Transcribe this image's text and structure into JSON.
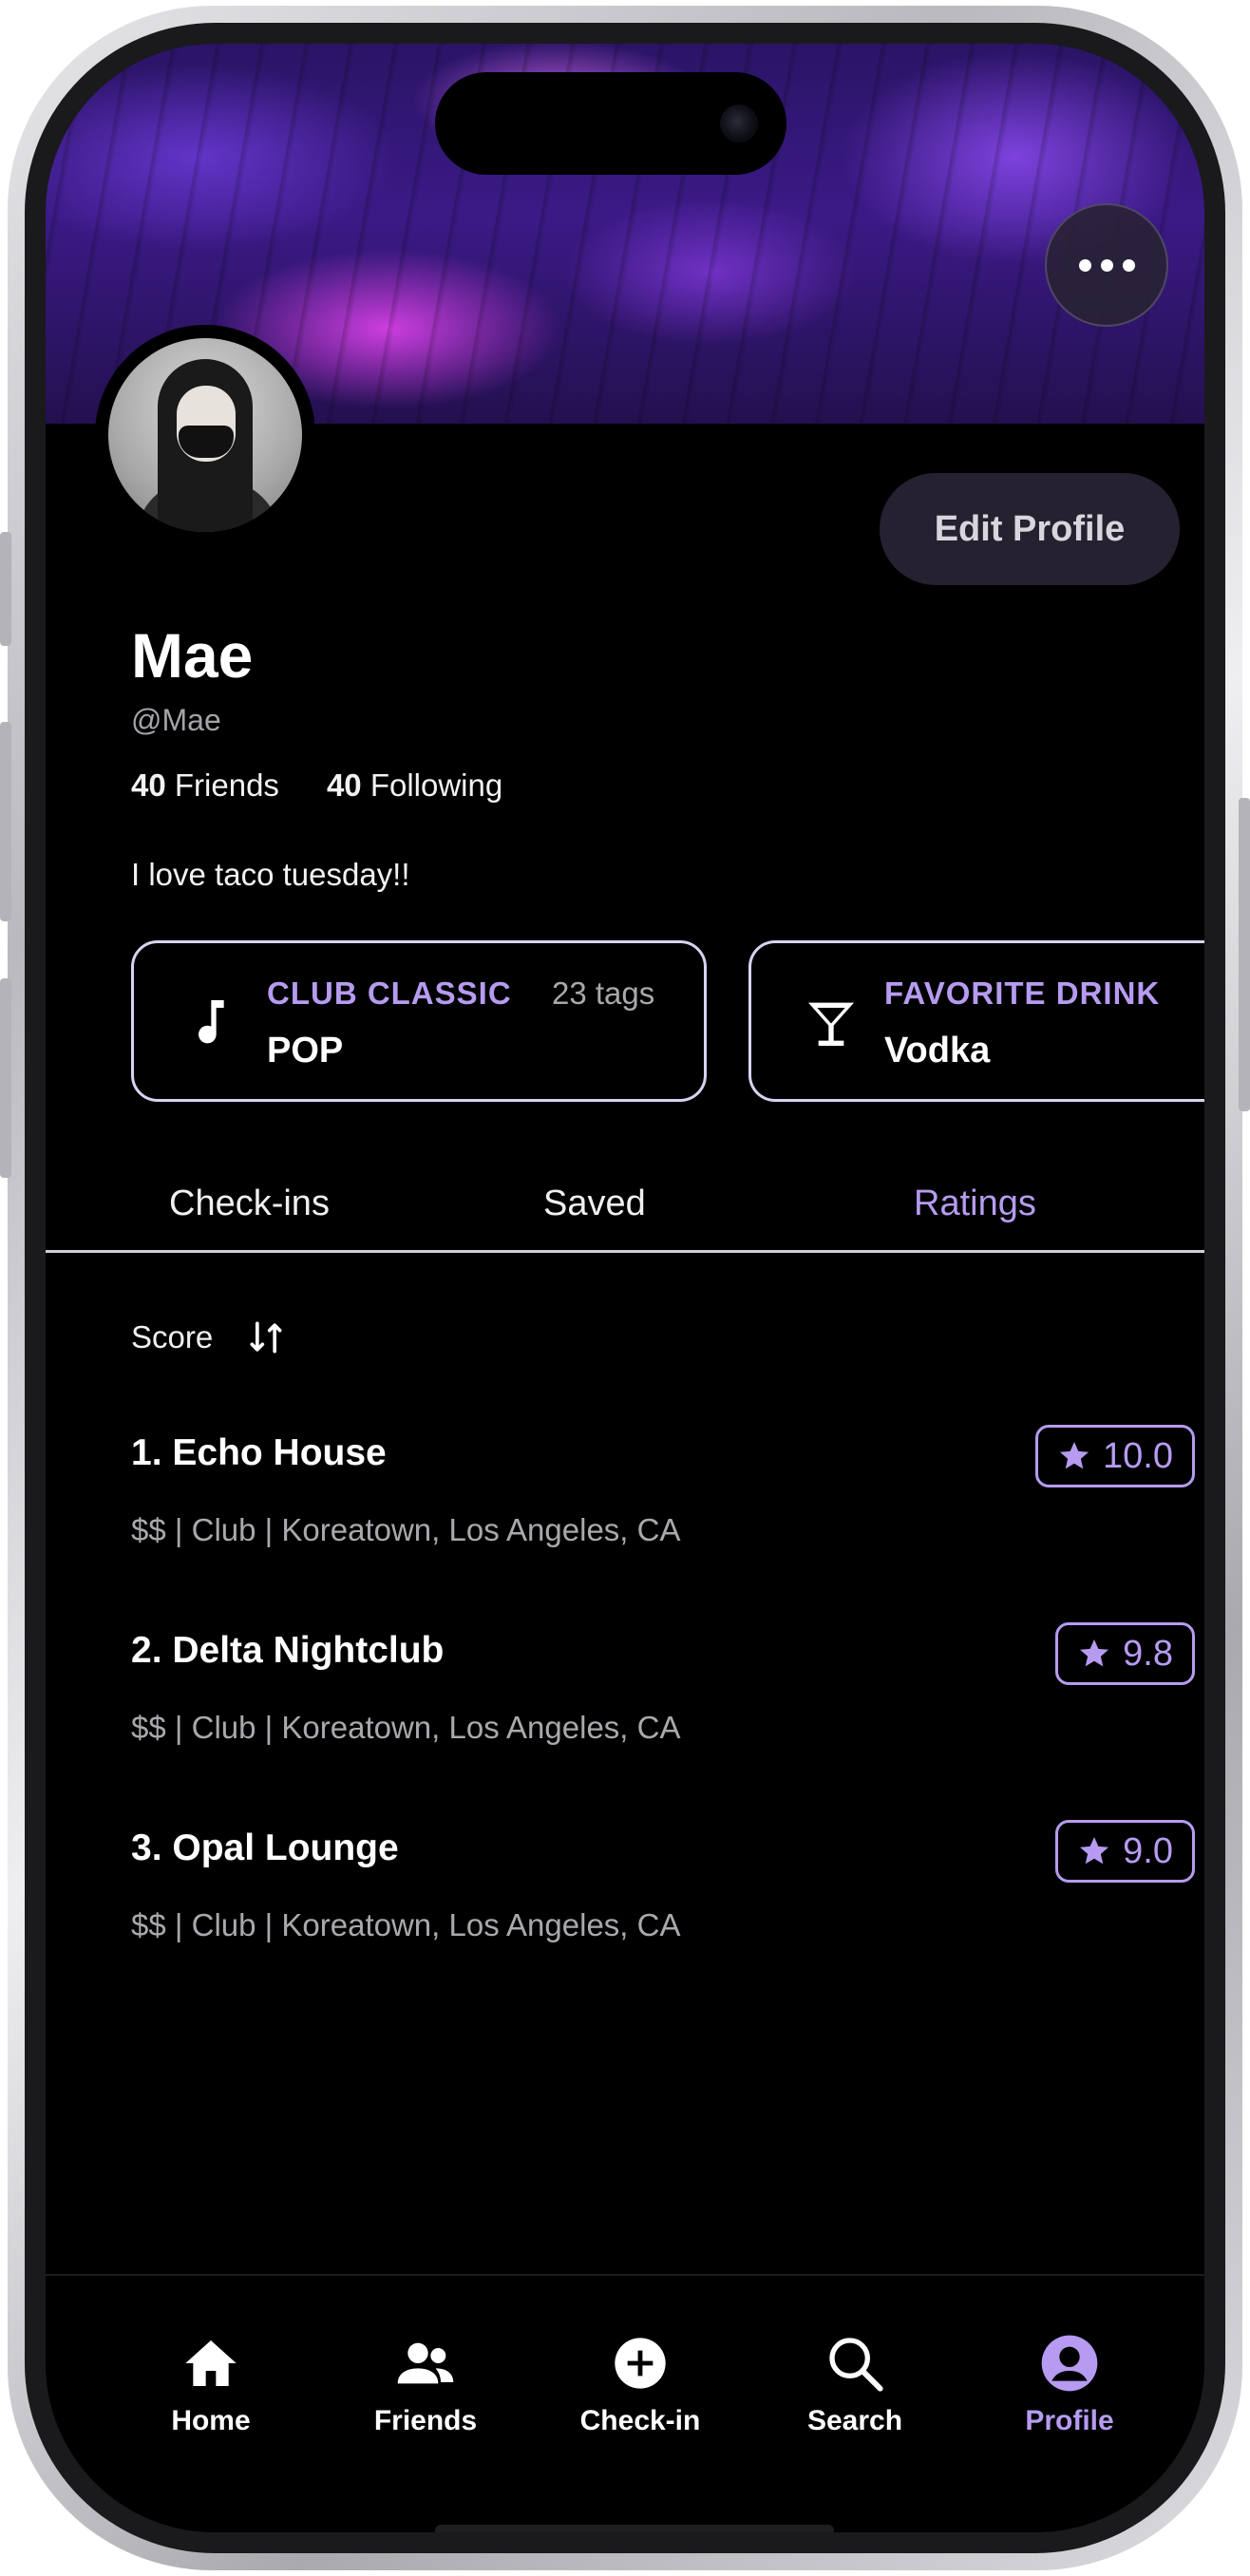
{
  "profile": {
    "name": "Mae",
    "handle": "@Mae",
    "friends_count": "40",
    "friends_label": "Friends",
    "following_count": "40",
    "following_label": "Following",
    "bio": "I love taco tuesday!!",
    "edit_label": "Edit Profile"
  },
  "cards": [
    {
      "title": "CLUB CLASSIC",
      "tags": "23 tags",
      "value": "POP",
      "icon": "music-note-icon"
    },
    {
      "title": "FAVORITE DRINK",
      "value": "Vodka",
      "icon": "cocktail-icon"
    }
  ],
  "tabs": [
    {
      "label": "Check-ins",
      "active": false
    },
    {
      "label": "Saved",
      "active": false
    },
    {
      "label": "Ratings",
      "active": true
    }
  ],
  "sort": {
    "label": "Score",
    "icon": "sort-icon"
  },
  "ratings": [
    {
      "name": "1. Echo House",
      "meta": "$$ | Club | Koreatown, Los Angeles, CA",
      "score": "10.0"
    },
    {
      "name": "2. Delta Nightclub",
      "meta": "$$ | Club | Koreatown, Los Angeles, CA",
      "score": "9.8"
    },
    {
      "name": "3. Opal Lounge",
      "meta": "$$ | Club | Koreatown, Los Angeles, CA",
      "score": "9.0"
    }
  ],
  "nav": [
    {
      "label": "Home",
      "icon": "home-icon"
    },
    {
      "label": "Friends",
      "icon": "friends-icon"
    },
    {
      "label": "Check-in",
      "icon": "plus-circle-icon"
    },
    {
      "label": "Search",
      "icon": "search-icon"
    },
    {
      "label": "Profile",
      "icon": "profile-icon",
      "active": true
    }
  ],
  "colors": {
    "accent": "#b69bf0",
    "background": "#000000",
    "muted": "#a9a9ad"
  }
}
